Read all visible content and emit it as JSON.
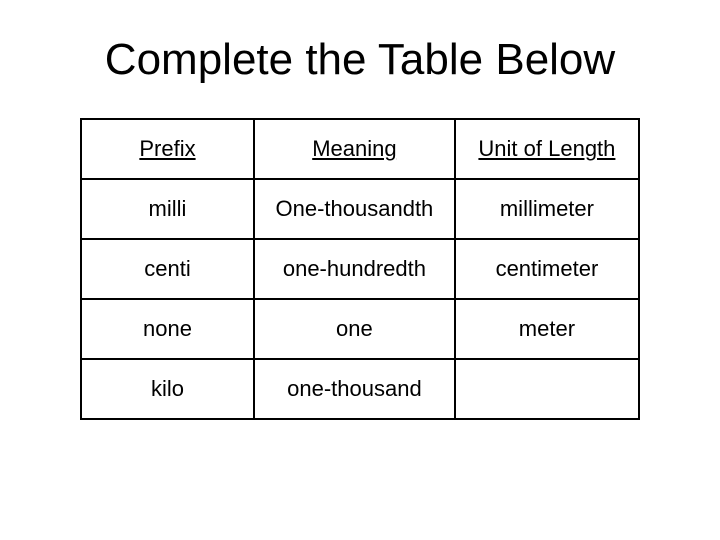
{
  "title": "Complete the Table Below",
  "headers": {
    "prefix": "Prefix",
    "meaning": "Meaning",
    "unit": "Unit of Length"
  },
  "rows": [
    {
      "prefix": "milli",
      "meaning": "One-thousandth",
      "unit": "millimeter"
    },
    {
      "prefix": "centi",
      "meaning": "one-hundredth",
      "unit": "centimeter"
    },
    {
      "prefix": "none",
      "meaning": "one",
      "unit": "meter"
    },
    {
      "prefix": "kilo",
      "meaning": "one-thousand",
      "unit": ""
    }
  ]
}
